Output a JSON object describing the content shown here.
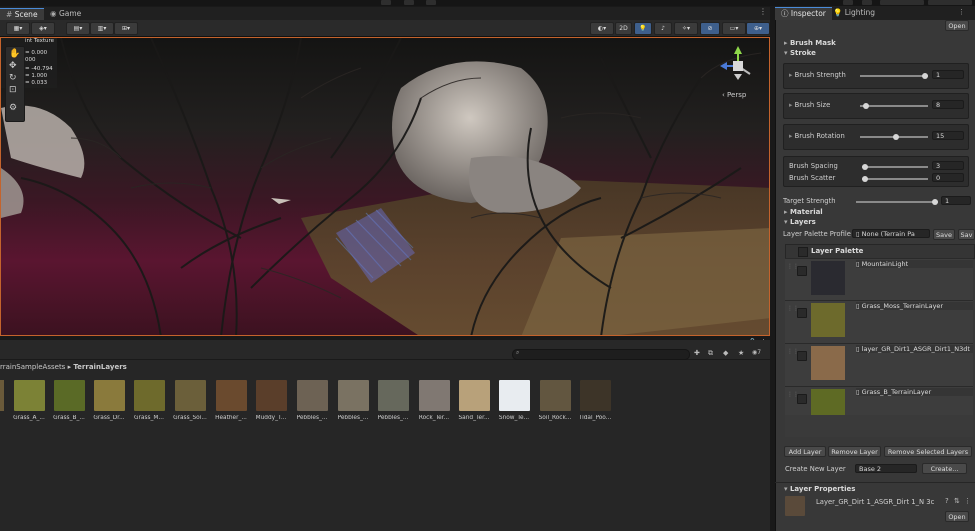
{
  "tabs": {
    "scene": "Scene",
    "game": "Game",
    "inspector": "Inspector",
    "lighting": "Lighting"
  },
  "scene_toolbar": {
    "mode_2d": "2D",
    "persp_label": "Persp"
  },
  "overlay": {
    "title": "int Texture",
    "lines": [
      "= 0.000",
      "000",
      "= -40.794",
      "= 1.000",
      "= 0.033"
    ]
  },
  "project": {
    "breadcrumb_root": "rrainSampleAssets",
    "breadcrumb_sep": "▸",
    "breadcrumb_leaf": "TerrainLayers",
    "count_badge": "7",
    "assets": [
      {
        "label": "Grass_A_...",
        "color": "#7c8236"
      },
      {
        "label": "Grass_B_...",
        "color": "#5a6a26"
      },
      {
        "label": "Grass_Dr...",
        "color": "#8a7a3c"
      },
      {
        "label": "Grass_M...",
        "color": "#6e6a2c"
      },
      {
        "label": "Grass_Soi...",
        "color": "#6b5f3a"
      },
      {
        "label": "Heather_...",
        "color": "#6a4a2e"
      },
      {
        "label": "Muddy_T...",
        "color": "#5a3e2a"
      },
      {
        "label": "Pebbles_...",
        "color": "#6d6254"
      },
      {
        "label": "Pebbles_...",
        "color": "#7a7262"
      },
      {
        "label": "Pebbles_...",
        "color": "#66685c"
      },
      {
        "label": "Rock_Ter...",
        "color": "#807872"
      },
      {
        "label": "Sand_Ter...",
        "color": "#b8a17a"
      },
      {
        "label": "Snow_Te...",
        "color": "#e8ecf0"
      },
      {
        "label": "Soil_Rock...",
        "color": "#625640"
      },
      {
        "label": "Tidal_Poo...",
        "color": "#3d3428"
      }
    ]
  },
  "inspector": {
    "open_label": "Open",
    "brush_mask": "Brush Mask",
    "stroke": "Stroke",
    "brush_strength": {
      "label": "Brush Strength",
      "value": "1",
      "level": 1.0
    },
    "brush_size": {
      "label": "Brush Size",
      "value": "8",
      "level": 0.05
    },
    "brush_rotation": {
      "label": "Brush Rotation",
      "value": "15",
      "level": 0.54
    },
    "brush_spacing": {
      "label": "Brush Spacing",
      "value": "3",
      "level": 0.0
    },
    "brush_scatter": {
      "label": "Brush Scatter",
      "value": "0",
      "level": 0.0
    },
    "target_strength": {
      "label": "Target Strength",
      "value": "1",
      "level": 1.0
    },
    "material": "Material",
    "layers": "Layers",
    "layer_palette_profile_label": "Layer Palette Profile",
    "layer_palette_profile_value": "None (Terrain Pa",
    "save_label": "Save",
    "save_as_label": "Sav",
    "layer_palette_title": "Layer Palette",
    "layer_items": [
      {
        "name": "MountainLight",
        "color": "#2a2a30"
      },
      {
        "name": "Grass_Moss_TerrainLayer",
        "color": "#6d6a2c"
      },
      {
        "name": "layer_GR_Dirt1_ASGR_Dirt1_N3dt",
        "color": "#8a6a4a"
      },
      {
        "name": "Grass_B_TerrainLayer",
        "color": "#5e6a24"
      }
    ],
    "add_layer": "Add Layer",
    "remove_layer": "Remove Layer",
    "remove_selected": "Remove Selected Layers",
    "create_new_layer_label": "Create New Layer",
    "create_new_layer_value": "Base 2",
    "create_button": "Create...",
    "layer_properties": "Layer Properties",
    "layer_properties_name": "Layer_GR_Dirt 1_ASGR_Dirt 1_N 3c",
    "layer_properties_open": "Open"
  }
}
